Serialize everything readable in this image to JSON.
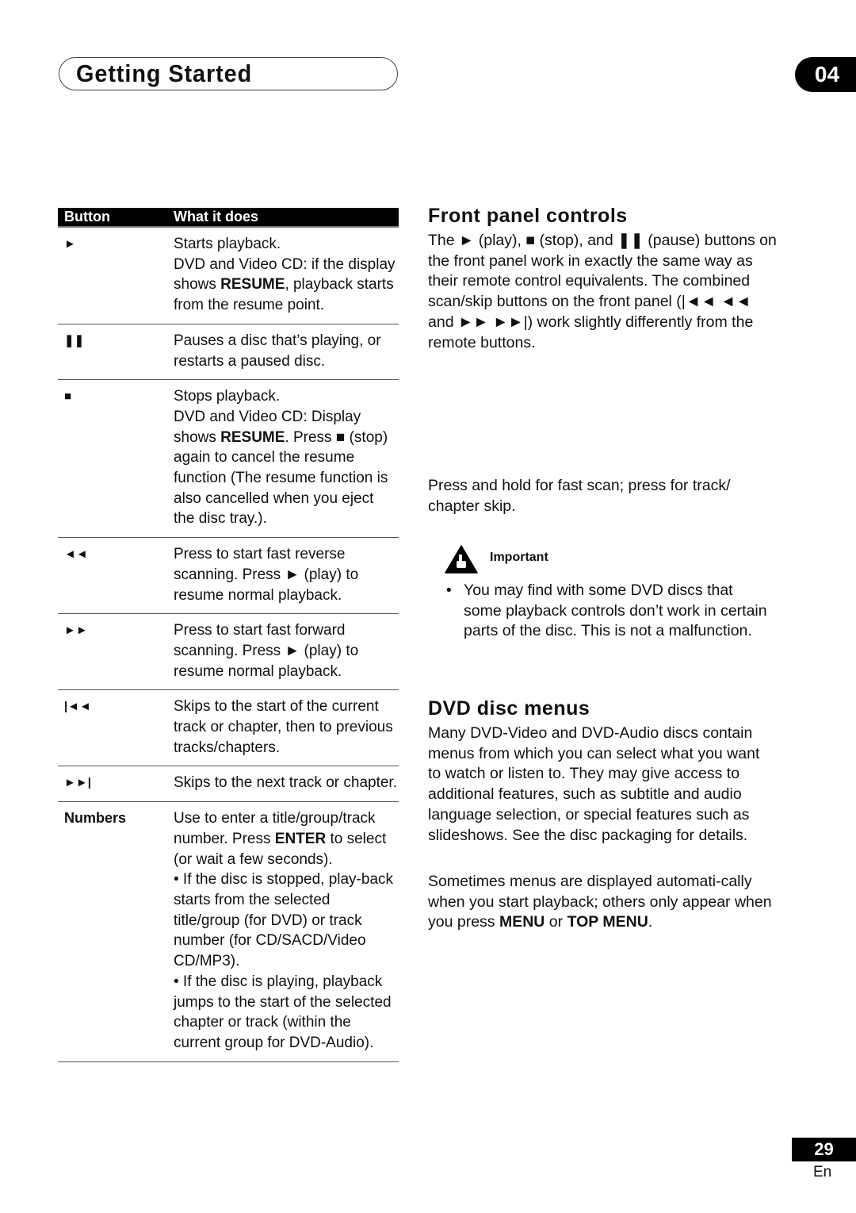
{
  "header": {
    "section_title": "Getting Started",
    "chapter_number": "04"
  },
  "table": {
    "columns": [
      "Button",
      "What it does"
    ],
    "rows": [
      {
        "button_icon": "play-icon",
        "button_symbol": "►",
        "button_label": "",
        "description": "Starts playback.\nDVD and Video CD: if the display shows ",
        "bold": "RESUME",
        "description_after": ", playback starts from the resume point."
      },
      {
        "button_icon": "pause-icon",
        "button_symbol": "❚❚",
        "button_label": "",
        "description": "Pauses a disc that’s playing, or restarts a paused disc.",
        "bold": "",
        "description_after": ""
      },
      {
        "button_icon": "stop-icon",
        "button_symbol": "■",
        "button_label": "",
        "description": "Stops playback.\nDVD and Video CD: Display shows ",
        "bold": "RESUME",
        "description_after": ". Press ■ (stop) again to cancel the resume function  (The resume function is also cancelled when you eject the disc tray.)."
      },
      {
        "button_icon": "rewind-icon",
        "button_symbol": "◄◄",
        "button_label": "",
        "description": "Press to start fast reverse scanning. Press ► (play) to resume normal playback.",
        "bold": "",
        "description_after": ""
      },
      {
        "button_icon": "fast-forward-icon",
        "button_symbol": "►►",
        "button_label": "",
        "description": "Press to start fast forward scanning. Press ► (play) to resume normal playback.",
        "bold": "",
        "description_after": ""
      },
      {
        "button_icon": "skip-previous-icon",
        "button_symbol": "|◄◄",
        "button_label": "",
        "description": "Skips to the start of the current track or chapter, then to previous tracks/chapters.",
        "bold": "",
        "description_after": ""
      },
      {
        "button_icon": "skip-next-icon",
        "button_symbol": "►►|",
        "button_label": "",
        "description": "Skips to the next track or chapter.",
        "bold": "",
        "description_after": ""
      },
      {
        "button_icon": "",
        "button_symbol": "",
        "button_label": "Numbers",
        "description": "Use to enter a title/group/track number. Press ",
        "bold": "ENTER",
        "description_after": " to select (or wait a few seconds).\n•  If the disc is stopped, play-back starts from the selected title/group (for DVD) or track number (for CD/SACD/Video CD/MP3).\n•  If the disc is playing, playback jumps to the start of the selected chapter or track (within the current group for DVD-Audio)."
      }
    ]
  },
  "front_panel": {
    "heading": "Front panel controls",
    "body": "The ► (play), ■ (stop), and ❚❚ (pause) buttons on the front panel work in exactly the same way as their remote control equivalents. The combined scan/skip buttons on the front panel (|◄◄ ◄◄ and ►► ►►|) work slightly differently from the remote buttons.",
    "note": "Press and hold for fast scan; press for track/ chapter skip."
  },
  "important": {
    "label": "Important",
    "icon": "warning-hand-icon",
    "bullet": "You may find with some DVD discs that some playback controls don’t work in certain parts of the disc. This is not a malfunction."
  },
  "dvd_menus": {
    "heading": "DVD disc menus",
    "para1": "Many DVD-Video and DVD-Audio discs contain menus from which you can select what you want to watch or listen to. They may give access to additional features, such as subtitle and audio language selection, or special features such as slideshows. See the disc packaging for details.",
    "para2_before": "Sometimes menus are displayed automati-cally when you start playback; others only appear when you press ",
    "para2_bold1": "MENU",
    "para2_mid": " or ",
    "para2_bold2": "TOP MENU",
    "para2_after": "."
  },
  "footer": {
    "page_number": "29",
    "language": "En"
  }
}
